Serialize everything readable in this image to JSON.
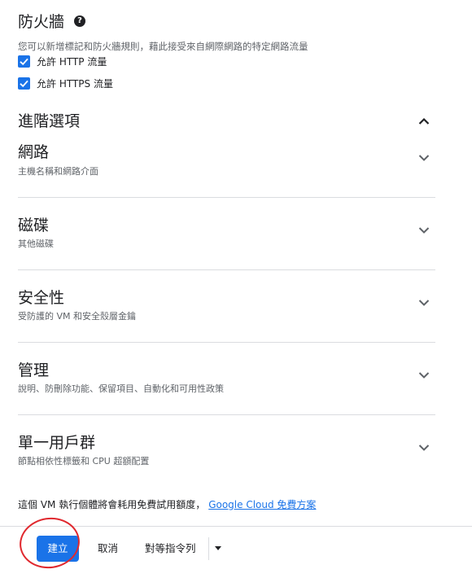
{
  "firewall": {
    "title": "防火牆",
    "help_icon": "help-circle-icon",
    "description": "您可以新增標記和防火牆規則，藉此接受來自網際網路的特定網路流量",
    "options": [
      {
        "label": "允許 HTTP 流量",
        "checked": true
      },
      {
        "label": "允許 HTTPS 流量",
        "checked": true
      }
    ]
  },
  "advanced": {
    "title": "進階選項",
    "state": "expanded",
    "sections": [
      {
        "title": "網路",
        "subtitle": "主機名稱和網路介面"
      },
      {
        "title": "磁碟",
        "subtitle": "其他磁碟"
      },
      {
        "title": "安全性",
        "subtitle": "受防護的 VM 和安全殼層金鑰"
      },
      {
        "title": "管理",
        "subtitle": "說明、防刪除功能、保留項目、自動化和可用性政策"
      },
      {
        "title": "單一用戶群",
        "subtitle": "節點相依性標籤和 CPU 超額配置"
      }
    ]
  },
  "note": {
    "text": "這個 VM 執行個體將會耗用免費試用額度，",
    "link": "Google Cloud 免費方案"
  },
  "actions": {
    "create": "建立",
    "cancel": "取消",
    "equivalent": "對等指令列"
  },
  "colors": {
    "primary": "#1a73e8",
    "annotation": "#e0282e"
  }
}
